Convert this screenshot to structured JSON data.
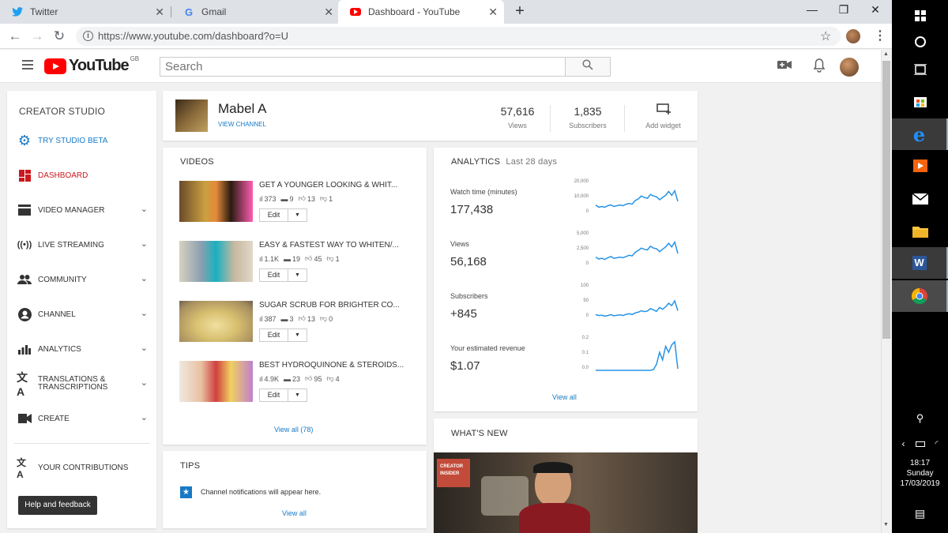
{
  "browser": {
    "tabs": [
      {
        "title": "Twitter",
        "icon": "twitter-bird-icon"
      },
      {
        "title": "Gmail",
        "icon": "google-g-icon"
      },
      {
        "title": "Dashboard - YouTube",
        "icon": "youtube-icon"
      }
    ],
    "url": "https://www.youtube.com/dashboard?o=U"
  },
  "header": {
    "logo_text": "YouTube",
    "region": "GB",
    "search_placeholder": "Search"
  },
  "sidebar": {
    "title": "CREATOR STUDIO",
    "items": [
      {
        "label": "TRY STUDIO BETA",
        "icon": "gear-icon"
      },
      {
        "label": "DASHBOARD",
        "icon": "dashboard-icon"
      },
      {
        "label": "VIDEO MANAGER",
        "icon": "video-manager-icon"
      },
      {
        "label": "LIVE STREAMING",
        "icon": "live-icon"
      },
      {
        "label": "COMMUNITY",
        "icon": "community-icon"
      },
      {
        "label": "CHANNEL",
        "icon": "channel-icon"
      },
      {
        "label": "ANALYTICS",
        "icon": "analytics-icon"
      },
      {
        "label": "TRANSLATIONS & TRANSCRIPTIONS",
        "icon": "translate-icon"
      },
      {
        "label": "CREATE",
        "icon": "camera-icon"
      }
    ],
    "contributions": "YOUR CONTRIBUTIONS",
    "help": "Help and feedback"
  },
  "channel": {
    "name": "Mabel A",
    "view_channel": "VIEW CHANNEL",
    "views_value": "57,616",
    "views_label": "Views",
    "subs_value": "1,835",
    "subs_label": "Subscribers",
    "add_widget": "Add widget"
  },
  "videos": {
    "title": "VIDEOS",
    "items": [
      {
        "title": "GET A YOUNGER LOOKING & WHIT...",
        "views": "373",
        "comments": "9",
        "likes": "13",
        "dislikes": "1"
      },
      {
        "title": "EASY & FASTEST WAY TO WHITEN/...",
        "views": "1.1K",
        "comments": "19",
        "likes": "45",
        "dislikes": "1"
      },
      {
        "title": "SUGAR SCRUB FOR BRIGHTER CO...",
        "views": "387",
        "comments": "3",
        "likes": "13",
        "dislikes": "0"
      },
      {
        "title": "BEST HYDROQUINONE & STEROIDS...",
        "views": "4.9K",
        "comments": "23",
        "likes": "95",
        "dislikes": "4"
      }
    ],
    "edit_label": "Edit",
    "view_all": "View all (78)"
  },
  "tips": {
    "title": "TIPS",
    "text": "Channel notifications will appear here.",
    "view_all": "View all"
  },
  "analytics": {
    "title": "ANALYTICS",
    "period": "Last 28 days",
    "view_all": "View all",
    "metrics": [
      {
        "label": "Watch time (minutes)",
        "value": "177,438",
        "ticks": [
          "20,000",
          "10,000",
          "0"
        ]
      },
      {
        "label": "Views",
        "value": "56,168",
        "ticks": [
          "5,000",
          "2,500",
          "0"
        ]
      },
      {
        "label": "Subscribers",
        "value": "+845",
        "ticks": [
          "100",
          "50",
          "0"
        ]
      },
      {
        "label": "Your estimated revenue",
        "value": "$1.07",
        "ticks": [
          "0.2",
          "0.1",
          "0.0"
        ]
      }
    ]
  },
  "chart_data": [
    {
      "type": "line",
      "title": "Watch time (minutes)",
      "ylim": [
        0,
        20000
      ],
      "values": [
        6000,
        4500,
        5000,
        4500,
        5500,
        6000,
        5000,
        5500,
        6000,
        5500,
        6500,
        7000,
        6500,
        9000,
        10000,
        12000,
        11000,
        10500,
        13000,
        12000,
        11500,
        9500,
        11000,
        12500,
        15000,
        12500,
        15500,
        8500
      ]
    },
    {
      "type": "line",
      "title": "Views",
      "ylim": [
        0,
        5000
      ],
      "values": [
        1500,
        1200,
        1300,
        1100,
        1400,
        1600,
        1300,
        1400,
        1500,
        1400,
        1600,
        1800,
        1700,
        2300,
        2600,
        3000,
        2800,
        2700,
        3300,
        3000,
        2900,
        2400,
        2800,
        3200,
        3800,
        3200,
        4000,
        2100
      ]
    },
    {
      "type": "line",
      "title": "Subscribers",
      "ylim": [
        0,
        100
      ],
      "values": [
        12,
        9,
        10,
        7,
        9,
        12,
        8,
        10,
        11,
        9,
        13,
        15,
        12,
        18,
        20,
        25,
        22,
        24,
        32,
        28,
        23,
        36,
        30,
        38,
        50,
        42,
        58,
        25
      ]
    },
    {
      "type": "line",
      "title": "Your estimated revenue",
      "ylim": [
        0,
        0.2
      ],
      "values": [
        0,
        0,
        0,
        0,
        0,
        0,
        0,
        0,
        0,
        0,
        0,
        0,
        0,
        0,
        0,
        0,
        0,
        0,
        0,
        0.005,
        0.04,
        0.12,
        0.07,
        0.16,
        0.12,
        0.17,
        0.19,
        0.01
      ]
    }
  ],
  "whats_new": {
    "title": "WHAT'S NEW",
    "badge": "CREATOR INSIDER"
  },
  "taskbar": {
    "time": "18:17",
    "day": "Sunday",
    "date": "17/03/2019"
  }
}
